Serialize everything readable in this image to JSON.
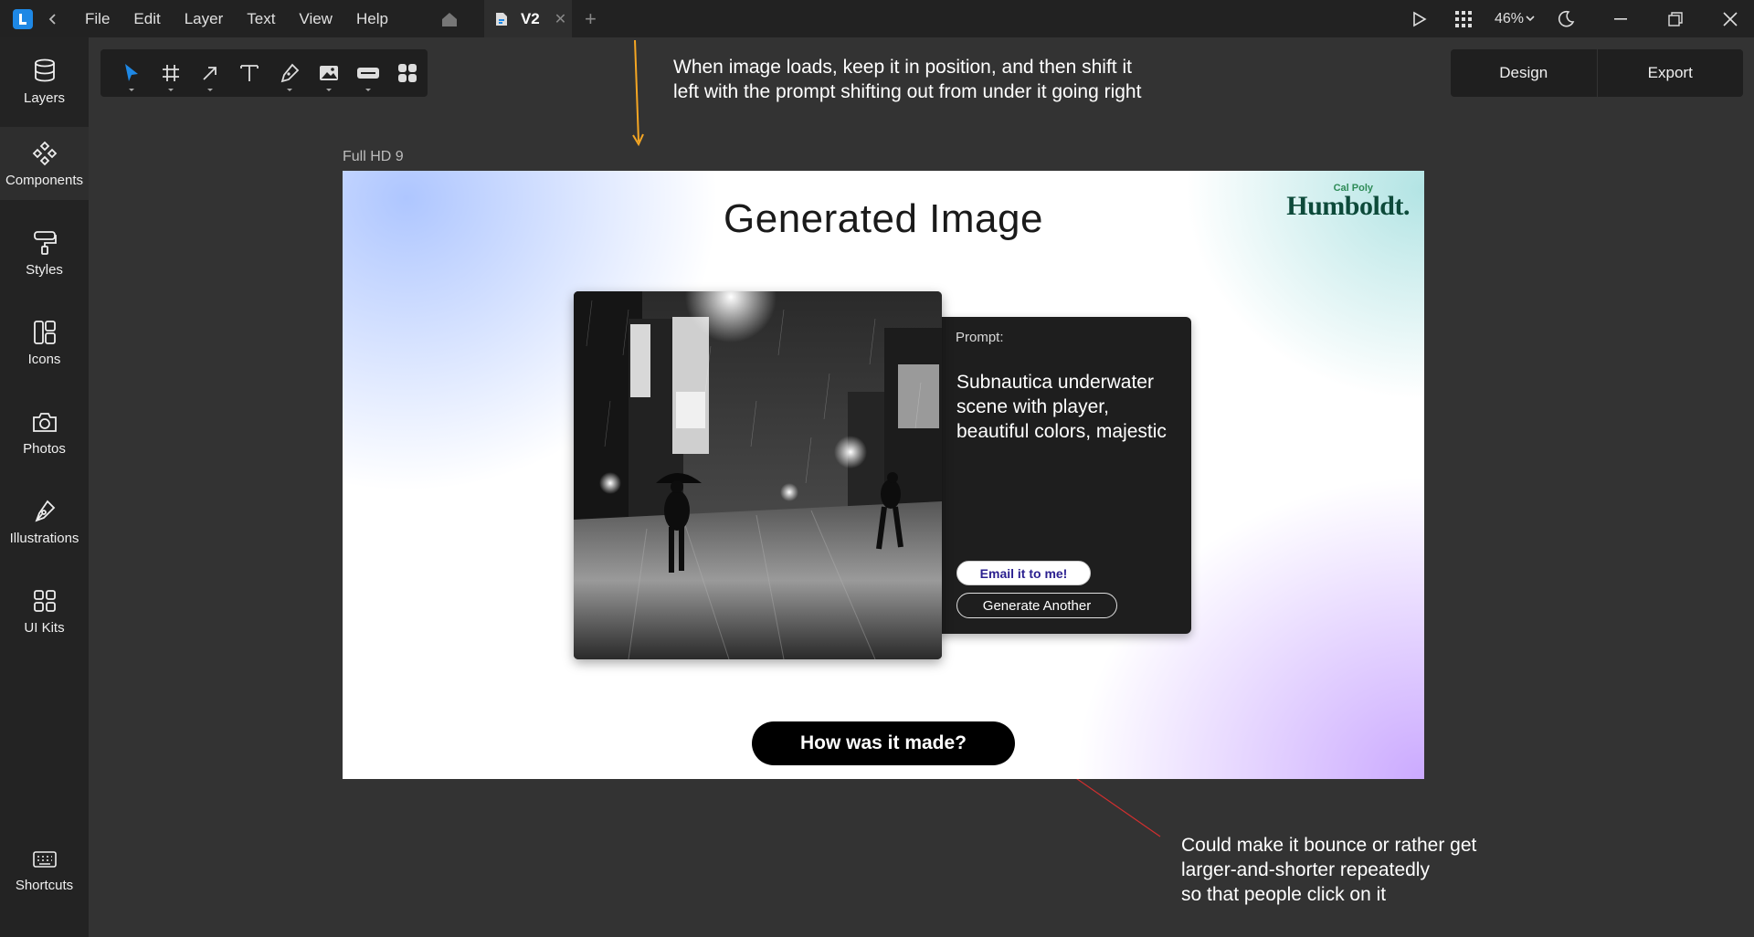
{
  "menu": {
    "items": [
      "File",
      "Edit",
      "Layer",
      "Text",
      "View",
      "Help"
    ]
  },
  "tab": {
    "name": "V2",
    "close": "✕",
    "add": "+"
  },
  "toolbar_right": {
    "zoom": "46%"
  },
  "sidebar": {
    "items": [
      {
        "label": "Layers",
        "icon": "layers-icon"
      },
      {
        "label": "Components",
        "icon": "components-icon"
      },
      {
        "label": "Styles",
        "icon": "paint-roller-icon"
      },
      {
        "label": "Icons",
        "icon": "icons-icon"
      },
      {
        "label": "Photos",
        "icon": "camera-icon"
      },
      {
        "label": "Illustrations",
        "icon": "pen-nib-icon"
      },
      {
        "label": "UI Kits",
        "icon": "grid-icon"
      }
    ],
    "shortcuts": "Shortcuts"
  },
  "tools": [
    "pointer-icon",
    "frame-icon",
    "arrow-icon",
    "text-icon",
    "pen-icon",
    "image-icon",
    "button-icon",
    "component-icon"
  ],
  "mode": {
    "design": "Design",
    "export": "Export"
  },
  "notes": {
    "top": "When image loads, keep it in position, and then shift it left with the prompt shifting out from under it going right",
    "bottom_lines": [
      "Could make it bounce or rather get",
      "larger-and-shorter repeatedly",
      "so that people click on it"
    ]
  },
  "frame": {
    "label": "Full HD 9",
    "title": "Generated Image",
    "logo_small": "Cal Poly",
    "logo_big": "Humboldt.",
    "prompt_label": "Prompt:",
    "prompt_text": "Subnautica underwater scene with player, beautiful colors, majestic",
    "email_button": "Email it to me!",
    "generate_button": "Generate Another",
    "how_button": "How was it made?"
  },
  "colors": {
    "accent": "#1e88e5",
    "note_arrow": "#f5a623",
    "note_arrow2": "#e53935"
  }
}
